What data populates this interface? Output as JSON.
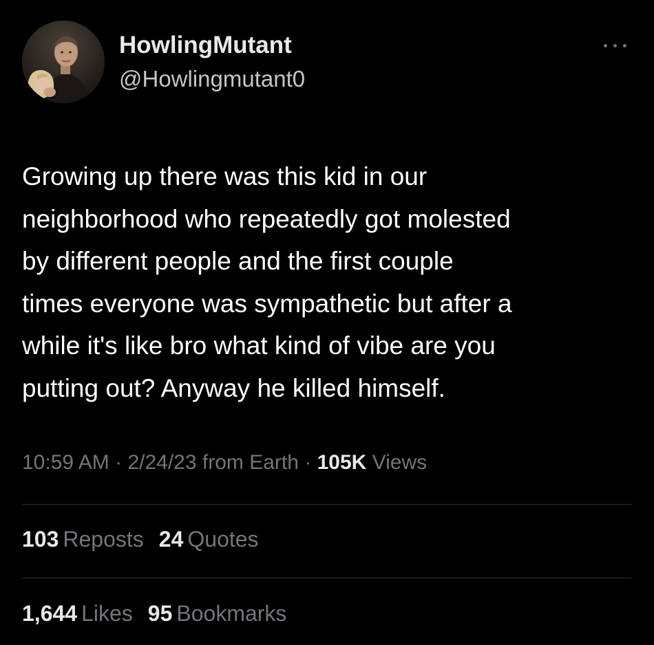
{
  "author": {
    "display_name": "HowlingMutant",
    "handle": "@Howlingmutant0",
    "avatar_icon": "profile-photo"
  },
  "more_icon": "ellipsis-icon",
  "tweet": {
    "lines": [
      "Growing up there was this kid in our",
      "neighborhood who repeatedly got molested",
      "by different people and the first couple",
      "times everyone was sympathetic but after a",
      "while it's like bro what kind of vibe are you",
      "putting out?  Anyway he killed himself."
    ]
  },
  "meta": {
    "time": "10:59 AM",
    "sep1": " · ",
    "date": "2/24/23",
    "source": " from Earth",
    "sep2": " · ",
    "views_count": "105K",
    "views_label": " Views"
  },
  "stats_row1": [
    {
      "count": "103",
      "label": "Reposts"
    },
    {
      "count": "24",
      "label": "Quotes"
    }
  ],
  "stats_row2": [
    {
      "count": "1,644",
      "label": "Likes"
    },
    {
      "count": "95",
      "label": "Bookmarks"
    }
  ],
  "colors": {
    "background": "#000000",
    "primary_text": "#e7e9ea",
    "secondary_text": "#71767b",
    "divider": "#2f3336"
  }
}
